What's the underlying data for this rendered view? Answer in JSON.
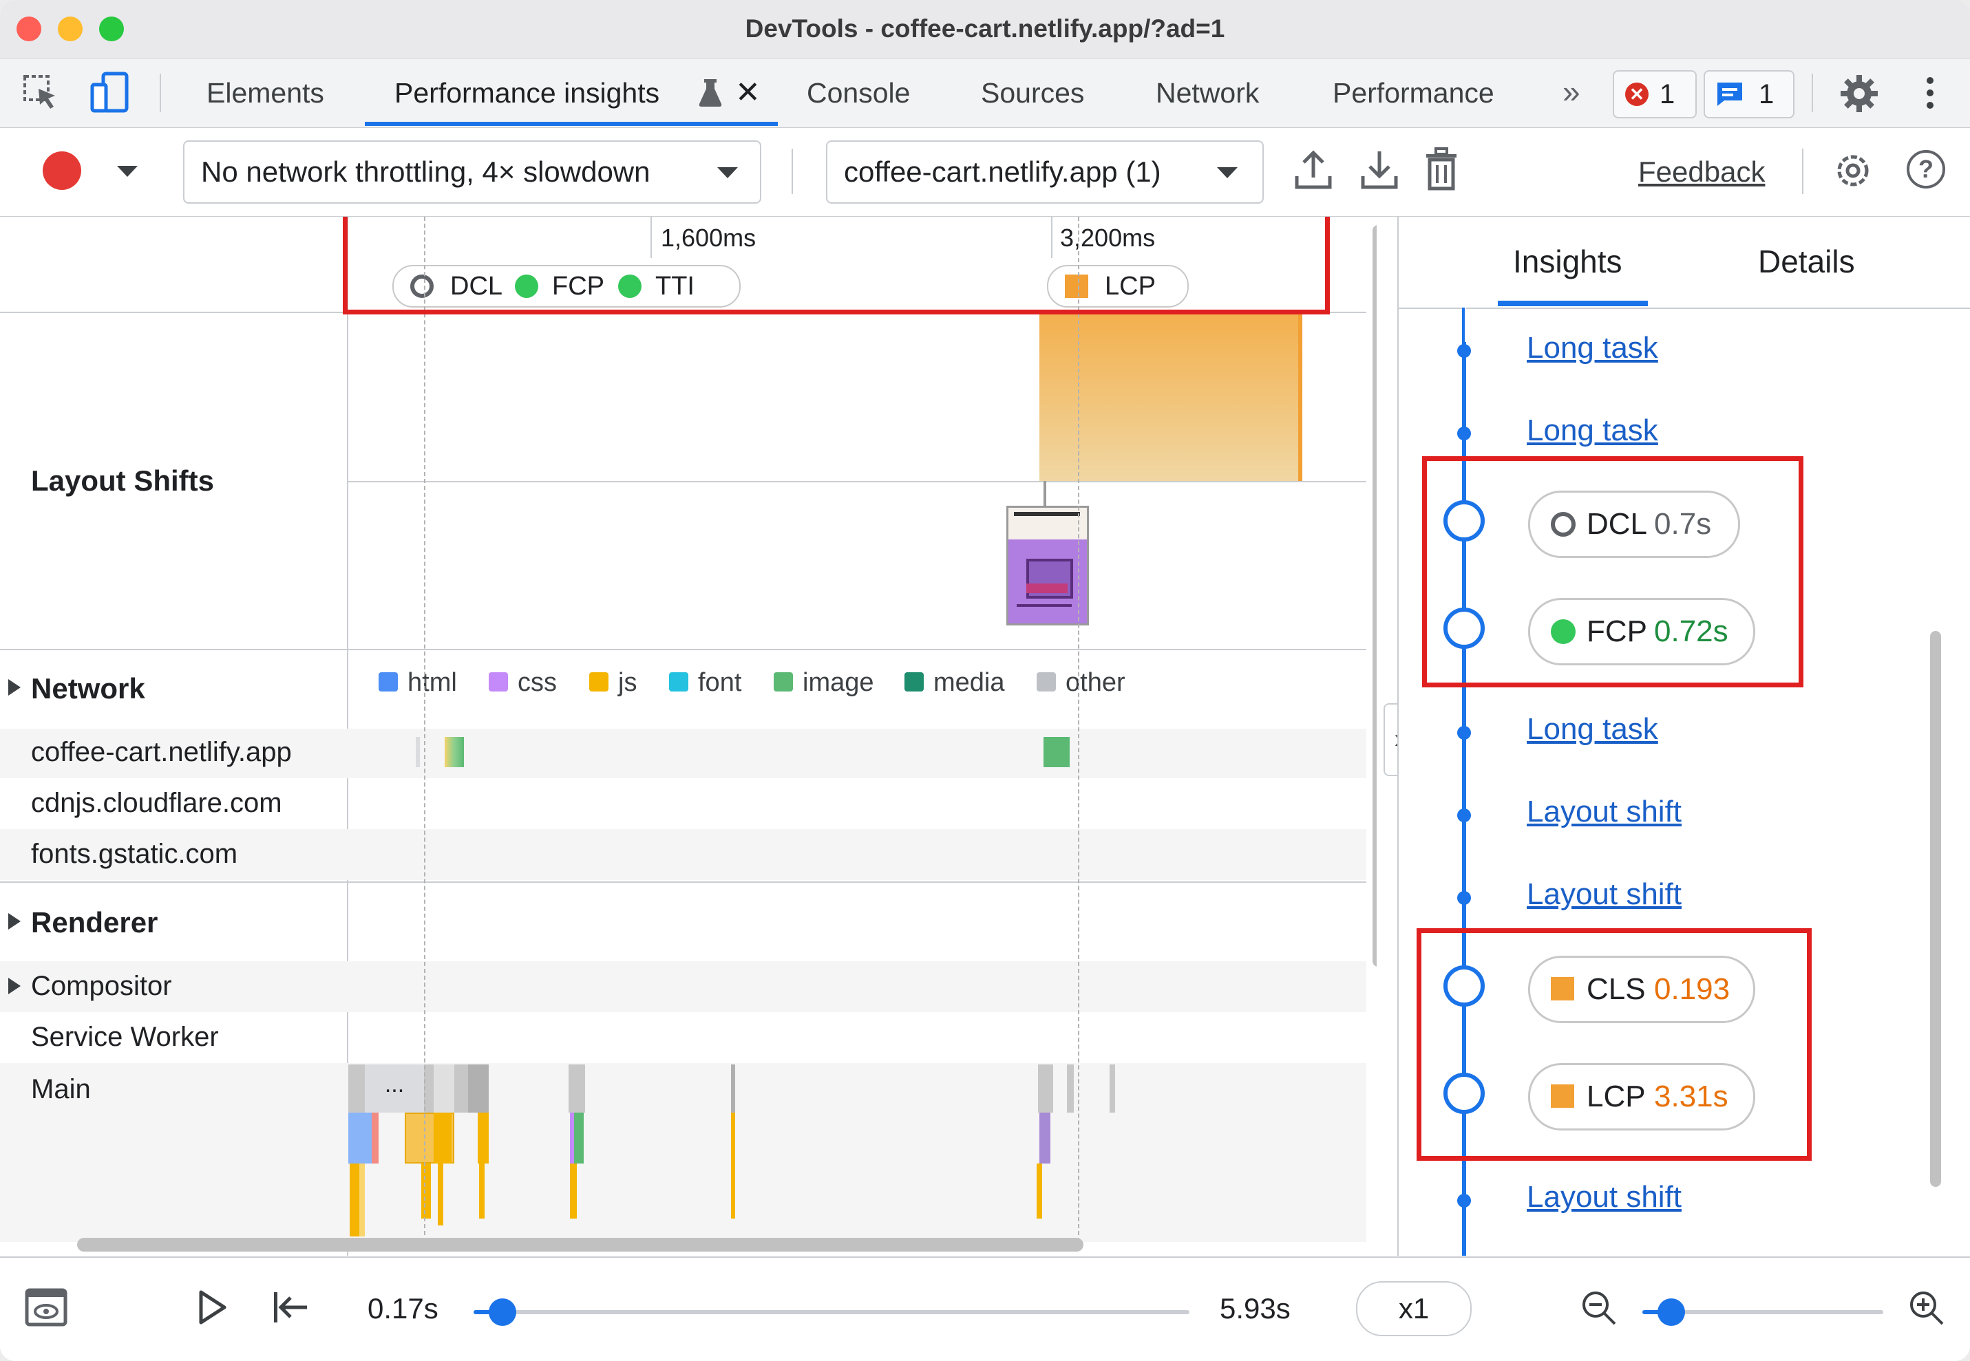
{
  "window": {
    "title": "DevTools - coffee-cart.netlify.app/?ad=1"
  },
  "tabs": [
    {
      "label": "Elements"
    },
    {
      "label": "Performance insights"
    },
    {
      "label": "Console"
    },
    {
      "label": "Sources"
    },
    {
      "label": "Network"
    },
    {
      "label": "Performance"
    }
  ],
  "badges": {
    "errors": "1",
    "messages": "1"
  },
  "toolbar": {
    "throttling": "No network throttling, 4× slowdown",
    "recording": "coffee-cart.netlify.app (1)",
    "feedback": "Feedback"
  },
  "timeline": {
    "ticks": [
      "1,600ms",
      "3,200ms"
    ],
    "markers": {
      "dcl": "DCL",
      "fcp": "FCP",
      "tti": "TTI",
      "lcp": "LCP"
    },
    "tracks": {
      "layout_shifts": "Layout Shifts",
      "network": "Network",
      "renderer": "Renderer",
      "compositor": "Compositor",
      "service_worker": "Service Worker",
      "main": "Main"
    },
    "hosts": [
      "coffee-cart.netlify.app",
      "cdnjs.cloudflare.com",
      "fonts.gstatic.com"
    ],
    "legend": [
      {
        "label": "html",
        "color": "#4c8df6"
      },
      {
        "label": "css",
        "color": "#c58af9"
      },
      {
        "label": "js",
        "color": "#f4b400"
      },
      {
        "label": "font",
        "color": "#24c1e0"
      },
      {
        "label": "image",
        "color": "#5bb974"
      },
      {
        "label": "media",
        "color": "#1e8e6e"
      },
      {
        "label": "other",
        "color": "#bdc1c6"
      }
    ],
    "main_ellipsis": "..."
  },
  "sidebar": {
    "tabs": {
      "insights": "Insights",
      "details": "Details"
    },
    "items": [
      {
        "type": "link",
        "label": "Long task"
      },
      {
        "type": "link",
        "label": "Long task"
      },
      {
        "type": "metric",
        "name": "DCL",
        "value": "0.7s",
        "color": "#5f6368"
      },
      {
        "type": "metric",
        "name": "FCP",
        "value": "0.72s",
        "color": "#1e8e3e"
      },
      {
        "type": "link",
        "label": "Long task"
      },
      {
        "type": "link",
        "label": "Layout shift"
      },
      {
        "type": "link",
        "label": "Layout shift"
      },
      {
        "type": "metric",
        "name": "CLS",
        "value": "0.193",
        "color": "#e8710a"
      },
      {
        "type": "metric",
        "name": "LCP",
        "value": "3.31s",
        "color": "#e8710a"
      },
      {
        "type": "link",
        "label": "Layout shift"
      }
    ]
  },
  "playback": {
    "start": "0.17s",
    "end": "5.93s",
    "speed": "x1",
    "progress": 0.04,
    "zoom": 0.12
  }
}
